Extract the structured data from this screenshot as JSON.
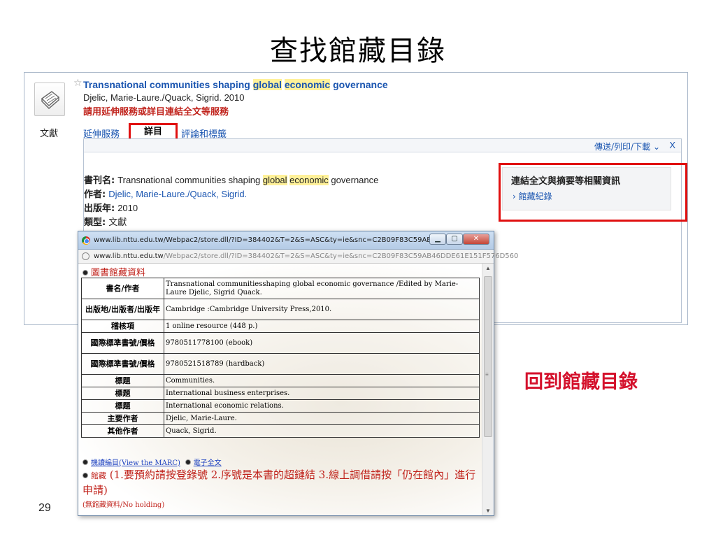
{
  "slide": {
    "title": "查找館藏目錄",
    "return_caption": "回到館藏目錄",
    "page_number": "29"
  },
  "record": {
    "type_label": "文獻",
    "title_parts": [
      "Transnational communities shaping ",
      "global",
      " ",
      "economic",
      " governance"
    ],
    "authors_year": "Djelic, Marie-Laure./Quack, Sigrid. 2010",
    "service_note": "請用延伸服務或詳目連結全文等服務",
    "tabs": {
      "extended": "延伸服務",
      "detail": "詳目",
      "review": "評論和標籤"
    },
    "toolbar": {
      "send": "傳送/列印/下載",
      "close": "X"
    },
    "fields": {
      "journal_label": "書刊名:",
      "journal_parts": [
        "Transnational communities shaping ",
        "global",
        " ",
        "economic",
        " governance"
      ],
      "author_label": "作者:",
      "author_value": "Djelic, Marie-Laure./Quack, Sigrid.",
      "year_label": "出版年:",
      "year_value": "2010",
      "type_label": "類型:",
      "type_value": "文獻"
    },
    "fulltext": {
      "heading": "連結全文與摘要等相關資訊",
      "link": "館藏紀錄"
    }
  },
  "popup": {
    "window_title": "www.lib.nttu.edu.tw/Webpac2/store.dll/?ID=384402&T=2&S=ASC&ty=ie&snc=C2B09F83C59AB46DD...",
    "address_host": "www.lib.nttu.edu.tw",
    "address_path": "/Webpac2/store.dll/?ID=384402&T=2&S=ASC&ty=ie&snc=C2B09F83C59AB46DDE61E151F576D560",
    "section_heading": "圖書館藏資料",
    "rows": [
      {
        "label": "書名/作者",
        "value": "Transnational communitiesshaping global economic governance /Edited by Marie-Laure Djelic, Sigrid Quack."
      },
      {
        "label": "出版地/出版者/出版年",
        "value": "Cambridge :Cambridge University Press,2010."
      },
      {
        "label": "稽核項",
        "value": "1 online resource (448 p.)"
      },
      {
        "label": "國際標準書號/價格",
        "value": "9780511778100 (ebook)"
      },
      {
        "label": "國際標準書號/價格",
        "value": "9780521518789 (hardback)"
      },
      {
        "label": "標題",
        "value": "Communities."
      },
      {
        "label": "標題",
        "value": "International business enterprises."
      },
      {
        "label": "標題",
        "value": "International economic relations."
      },
      {
        "label": "主要作者",
        "value": "Djelic, Marie-Laure."
      },
      {
        "label": "其他作者",
        "value": "Quack, Sigrid."
      }
    ],
    "marc_link": "機讀編目(View the MARC)",
    "fulltext_link": "電子全文",
    "holding_label": "館藏",
    "holding_note": "(1.要預約請按登錄號 2.序號是本書的超鏈結 3.線上調借請按「仍在館內」進行申請)",
    "no_holding": "(無館藏資料/No holding)"
  },
  "colors": {
    "link_blue": "#1a55b0",
    "accent_red": "#e01010",
    "highlight_yellow": "#fff199",
    "caption_red": "#d4112c"
  }
}
